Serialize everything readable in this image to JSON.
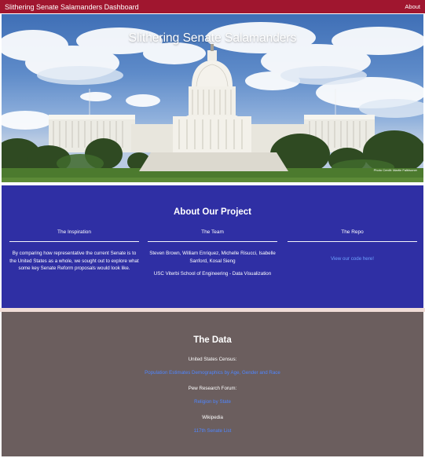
{
  "navbar": {
    "brand": "Slithering Senate Salamanders Dashboard",
    "about": "About",
    "color": "#a0162f"
  },
  "hero": {
    "title": "Slithering Senate Salamanders",
    "photo_credit": "Photo Credit: Martin Falbisoner"
  },
  "project": {
    "heading": "About Our Project",
    "background": "#2f2fa4",
    "columns": [
      {
        "heading": "The Inspiration",
        "text": "By comparing how representative the current Senate is to the United States as a whole, we sought out to explore what some key Senate Reform proposals would look like."
      },
      {
        "heading": "The Team",
        "members": "Steven Brown, William Enriquez, Michelle Risucci, Isabelle Sanford, Kosal Sieng",
        "school": "USC Viterbi School of Engineering - Data Visualization"
      },
      {
        "heading": "The Repo",
        "link": "View our code here!"
      }
    ]
  },
  "data": {
    "heading": "The Data",
    "background": "#6b5e5e",
    "sources": [
      {
        "name": "United States Census:",
        "link": "Population Estimates Demographics by Age, Gender and Race"
      },
      {
        "name": "Pew Research Forum:",
        "link": "Religion by State"
      },
      {
        "name": "Wikipedia",
        "link": "117th Senate List"
      }
    ]
  }
}
